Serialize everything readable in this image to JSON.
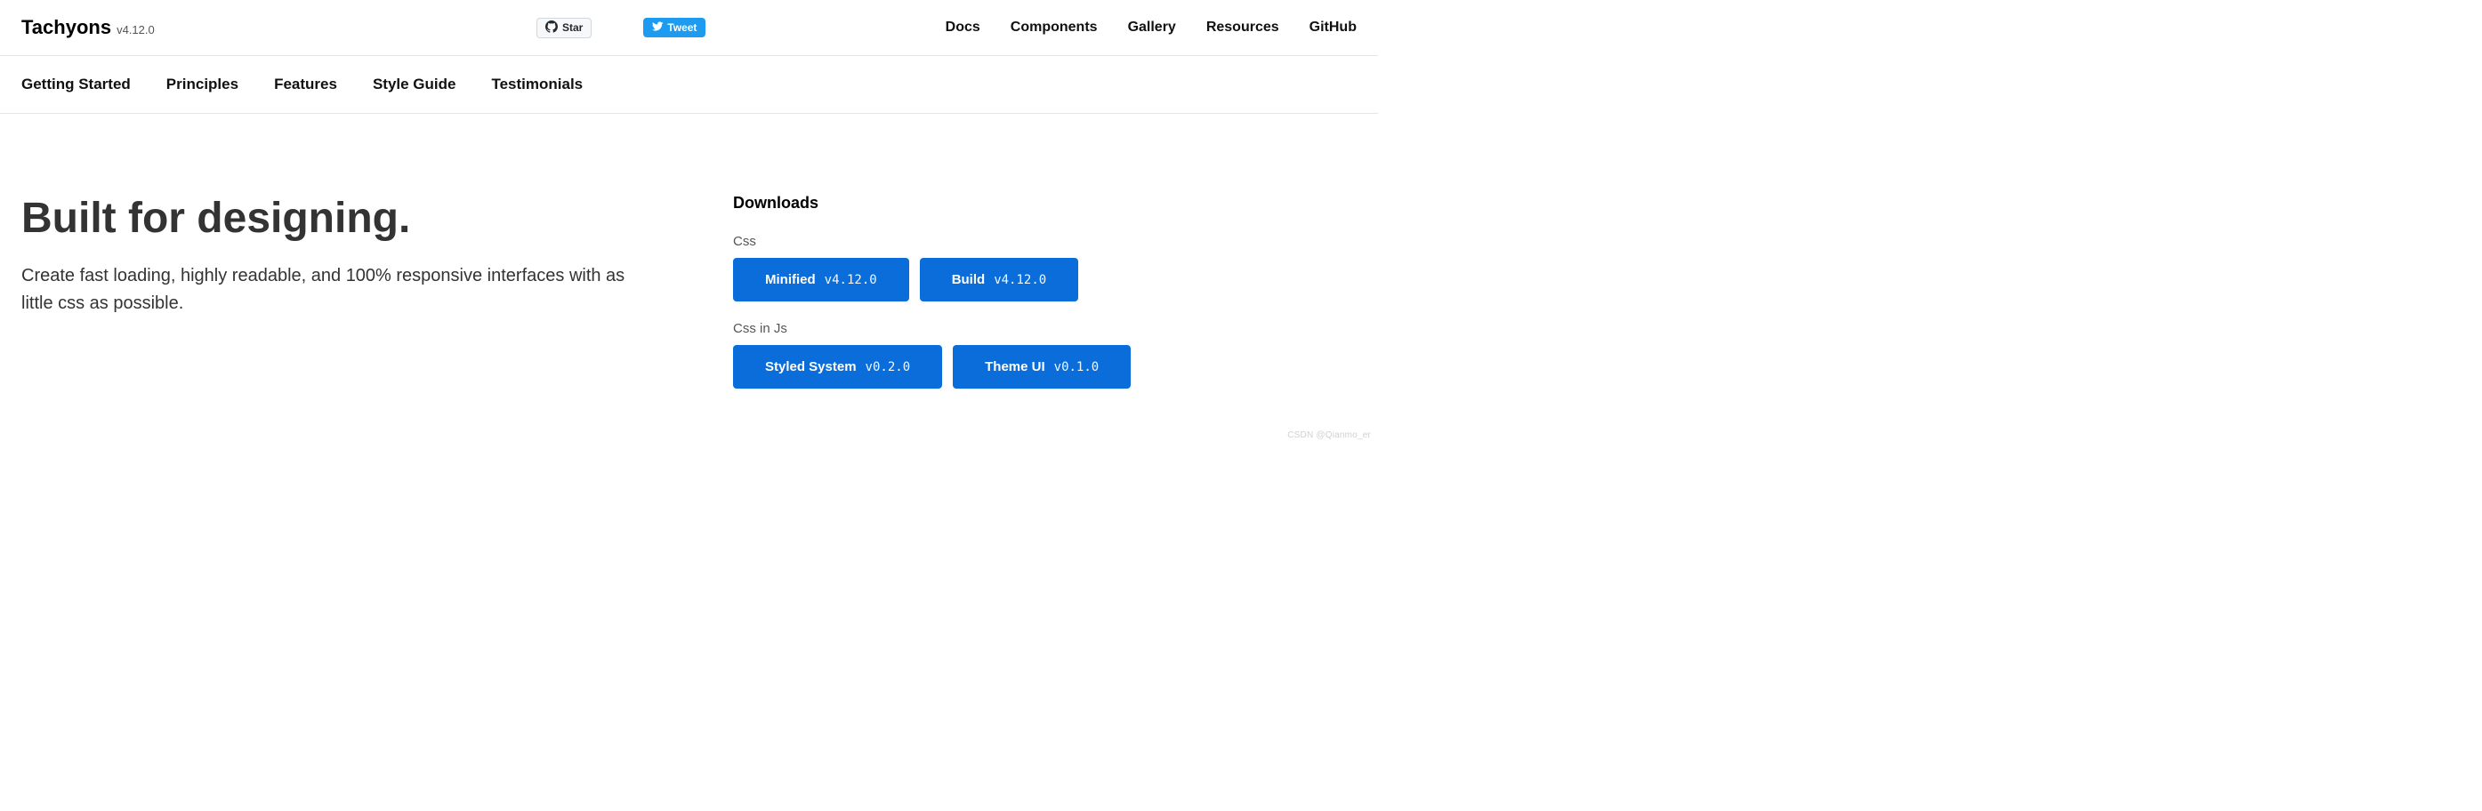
{
  "header": {
    "brand_name": "Tachyons",
    "brand_version": "v4.12.0",
    "github_star_label": "Star",
    "twitter_tweet_label": "Tweet",
    "nav": {
      "docs": "Docs",
      "components": "Components",
      "gallery": "Gallery",
      "resources": "Resources",
      "github": "GitHub"
    }
  },
  "subnav": {
    "getting_started": "Getting Started",
    "principles": "Principles",
    "features": "Features",
    "style_guide": "Style Guide",
    "testimonials": "Testimonials"
  },
  "hero": {
    "title": "Built for designing.",
    "subtitle": "Create fast loading, highly readable, and 100% responsive interfaces with as little css as possible."
  },
  "downloads": {
    "heading": "Downloads",
    "groups": [
      {
        "label": "Css",
        "buttons": [
          {
            "label": "Minified",
            "version": "v4.12.0"
          },
          {
            "label": "Build",
            "version": "v4.12.0"
          }
        ]
      },
      {
        "label": "Css in Js",
        "buttons": [
          {
            "label": "Styled System",
            "version": "v0.2.0"
          },
          {
            "label": "Theme UI",
            "version": "v0.1.0"
          }
        ]
      }
    ]
  },
  "watermark": "CSDN @Qianmo_er"
}
